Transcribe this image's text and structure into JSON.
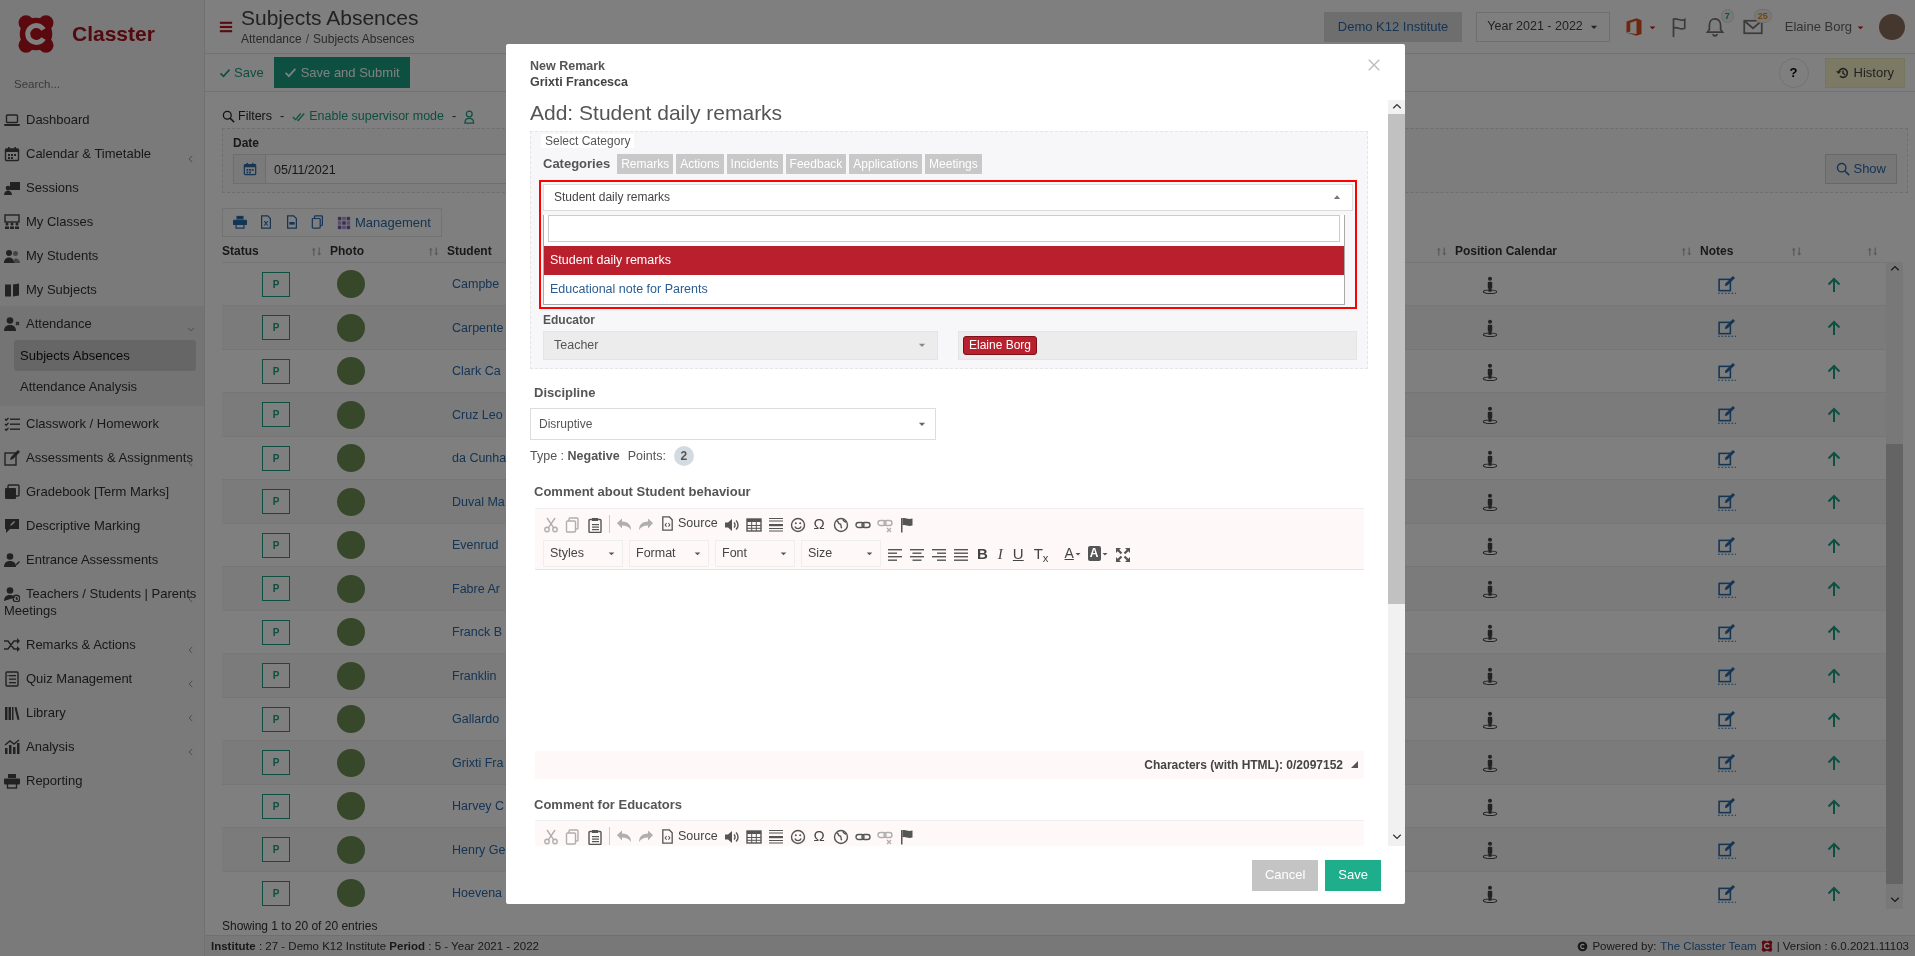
{
  "sidebar": {
    "brand": "Classter",
    "search_placeholder": "Search...",
    "items": [
      {
        "label": "Dashboard",
        "expandable": false
      },
      {
        "label": "Calendar & Timetable",
        "expandable": true,
        "expanded": false
      },
      {
        "label": "Sessions",
        "expandable": false
      },
      {
        "label": "My Classes",
        "expandable": false
      },
      {
        "label": "My Students",
        "expandable": false
      },
      {
        "label": "My Subjects",
        "expandable": false
      },
      {
        "label": "Attendance",
        "expandable": true,
        "expanded": true,
        "children": [
          {
            "label": "Subjects Absences",
            "selected": true
          },
          {
            "label": "Attendance Analysis",
            "selected": false
          }
        ]
      },
      {
        "label": "Classwork / Homework",
        "expandable": false
      },
      {
        "label": "Assessments & Assignments",
        "expandable": true,
        "expanded": false
      },
      {
        "label": "Gradebook [Term Marks]",
        "expandable": false
      },
      {
        "label": "Descriptive Marking",
        "expandable": false
      },
      {
        "label": "Entrance Assessments",
        "expandable": false
      },
      {
        "label": "Teachers / Students | Parents Meetings",
        "expandable": true,
        "expanded": false
      },
      {
        "label": "Remarks & Actions",
        "expandable": true,
        "expanded": false
      },
      {
        "label": "Quiz Management",
        "expandable": true,
        "expanded": false
      },
      {
        "label": "Library",
        "expandable": true,
        "expanded": false
      },
      {
        "label": "Analysis",
        "expandable": true,
        "expanded": false
      },
      {
        "label": "Reporting",
        "expandable": false
      }
    ]
  },
  "header": {
    "title": "Subjects Absences",
    "breadcrumb": [
      "Attendance",
      "Subjects Absences"
    ],
    "breadcrumb_separator": "/",
    "institute": "Demo K12 Institute",
    "year": "Year 2021 - 2022",
    "bell_count": "7",
    "mail_count": "25",
    "user_name": "Elaine Borg"
  },
  "toolbar": {
    "save": "Save",
    "save_submit": "Save and Submit",
    "help": "?",
    "history": "History"
  },
  "filters": {
    "items": [
      {
        "kind": "filter",
        "label": "Filters"
      },
      {
        "kind": "separator",
        "label": "-"
      },
      {
        "kind": "link",
        "label": "Enable supervisor mode"
      },
      {
        "kind": "separator",
        "label": "-"
      },
      {
        "kind": "icon"
      }
    ],
    "date_label": "Date",
    "date_value": "05/11/2021",
    "show": "Show"
  },
  "actions": {
    "management": "Management"
  },
  "table": {
    "columns": [
      "Status",
      "Photo",
      "Student",
      "Position Calendar",
      "Notes"
    ],
    "rows": [
      {
        "status": "P",
        "student": "Campbe"
      },
      {
        "status": "P",
        "student": "Carpente"
      },
      {
        "status": "P",
        "student": "Clark Ca"
      },
      {
        "status": "P",
        "student": "Cruz Leo"
      },
      {
        "status": "P",
        "student": "da Cunha"
      },
      {
        "status": "P",
        "student": "Duval Ma"
      },
      {
        "status": "P",
        "student": "Evenrud"
      },
      {
        "status": "P",
        "student": "Fabre Ar"
      },
      {
        "status": "P",
        "student": "Franck B"
      },
      {
        "status": "P",
        "student": "Franklin"
      },
      {
        "status": "P",
        "student": "Gallardo"
      },
      {
        "status": "P",
        "student": "Grixti Fra"
      },
      {
        "status": "P",
        "student": "Harvey C"
      },
      {
        "status": "P",
        "student": "Henry Ge"
      },
      {
        "status": "P",
        "student": "Hoevena"
      }
    ],
    "info": "Showing 1 to 20 of 20 entries"
  },
  "footer": {
    "context": "**Institute** : 27 - Demo K12 Institute **Period** : 5 - Year 2021 - 2022",
    "powered": "Powered by:",
    "team": "The Classter Team",
    "version": "| Version : 6.0.2021.11103"
  },
  "modal": {
    "title": "New Remark",
    "student": "Grixti Francesca",
    "heading": "Add: Student daily remarks",
    "legend": "Select Category",
    "categories_label": "Categories",
    "categories": [
      "Remarks",
      "Actions",
      "Incidents",
      "Feedback",
      "Applications",
      "Meetings"
    ],
    "category_select": {
      "value": "Student daily remarks",
      "expanded": true,
      "options": [
        {
          "label": "Student daily remarks",
          "selected": true
        },
        {
          "label": "Educational note for Parents",
          "selected": false
        }
      ]
    },
    "educator_label": "Educator",
    "educator_role": "Teacher",
    "educator_names": [
      "Elaine Borg"
    ],
    "discipline_label": "Discipline",
    "discipline_value": "Disruptive",
    "type_text": "Type : **Negative**",
    "points_label": "Points:",
    "points_value": "2",
    "editors": [
      {
        "label": "Comment about Student behaviour",
        "first_row": [
          {
            "kind": "tool",
            "disabled": true
          },
          {
            "kind": "tool",
            "disabled": true
          },
          {
            "kind": "tool",
            "disabled": false
          },
          {
            "kind": "separator"
          },
          {
            "kind": "tool",
            "disabled": true
          },
          {
            "kind": "tool",
            "disabled": true
          },
          {
            "kind": "text",
            "label": "Source",
            "disabled": false
          },
          {
            "kind": "tool",
            "disabled": false
          },
          {
            "kind": "tool",
            "disabled": false
          },
          {
            "kind": "tool",
            "disabled": false
          },
          {
            "kind": "tool",
            "disabled": false
          },
          {
            "kind": "glyph",
            "label": "Ω"
          },
          {
            "kind": "tool",
            "disabled": false
          },
          {
            "kind": "tool",
            "disabled": false
          },
          {
            "kind": "tool",
            "disabled": true
          },
          {
            "kind": "tool",
            "disabled": false
          }
        ],
        "second_row": [
          {
            "kind": "menu",
            "label": "Styles"
          },
          {
            "kind": "menu",
            "label": "Format"
          },
          {
            "kind": "menu",
            "label": "Font"
          },
          {
            "kind": "menu",
            "label": "Size"
          },
          {
            "kind": "tool",
            "disabled": false
          },
          {
            "kind": "tool",
            "disabled": false
          },
          {
            "kind": "tool",
            "disabled": false
          },
          {
            "kind": "tool",
            "disabled": false
          },
          {
            "kind": "bold",
            "label": "B"
          },
          {
            "kind": "italic",
            "label": "I"
          },
          {
            "kind": "underline",
            "label": "U"
          },
          {
            "kind": "glyph",
            "label": "T$_{x}$"
          },
          {
            "kind": "color",
            "label": "A"
          },
          {
            "kind": "bgcolor",
            "label": "A"
          },
          {
            "kind": "tool",
            "disabled": false
          }
        ],
        "char_count": "Characters (with HTML): 0/2097152"
      },
      {
        "label": "Comment for Educators",
        "first_row": [
          {
            "kind": "tool",
            "disabled": true
          },
          {
            "kind": "tool",
            "disabled": true
          },
          {
            "kind": "tool",
            "disabled": false
          },
          {
            "kind": "separator"
          },
          {
            "kind": "tool",
            "disabled": true
          },
          {
            "kind": "tool",
            "disabled": true
          },
          {
            "kind": "text",
            "label": "Source",
            "disabled": false
          },
          {
            "kind": "tool",
            "disabled": false
          },
          {
            "kind": "tool",
            "disabled": false
          },
          {
            "kind": "tool",
            "disabled": false
          },
          {
            "kind": "tool",
            "disabled": false
          },
          {
            "kind": "glyph",
            "label": "Ω"
          },
          {
            "kind": "tool",
            "disabled": false
          },
          {
            "kind": "tool",
            "disabled": false
          },
          {
            "kind": "tool",
            "disabled": true
          },
          {
            "kind": "tool",
            "disabled": false
          }
        ]
      }
    ],
    "buttons": [
      {
        "kind": "cancel",
        "label": "Cancel"
      },
      {
        "kind": "save",
        "label": "Save"
      }
    ]
  }
}
